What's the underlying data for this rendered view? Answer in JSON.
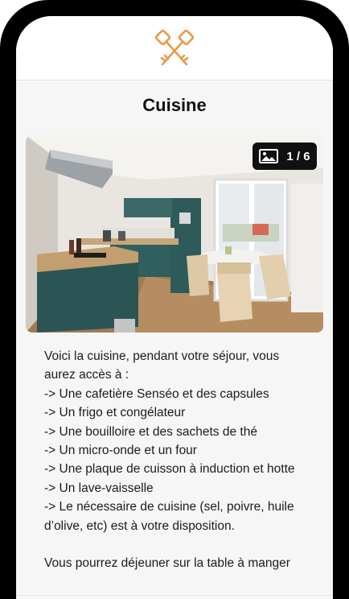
{
  "header": {
    "logo_icon": "crossed-keys-icon",
    "accent_color": "#e89a4a"
  },
  "page": {
    "title": "Cuisine"
  },
  "gallery": {
    "counter": "1 / 6",
    "counter_icon": "image-icon"
  },
  "description": {
    "lines": [
      "Voici la cuisine, pendant votre séjour, vous aurez accès à :",
      "-> Une cafetière Senséo et des capsules",
      "-> Un frigo et congélateur",
      "-> Une bouilloire et des sachets de thé",
      "-> Un micro-onde et un four",
      "-> Une plaque de cuisson à induction et hotte",
      "-> Un lave-vaisselle",
      "-> Le nécessaire de cuisine (sel, poivre, huile d’olive, etc) est à votre disposition."
    ],
    "next_paragraph": "Vous pourrez déjeuner sur la table à manger"
  }
}
